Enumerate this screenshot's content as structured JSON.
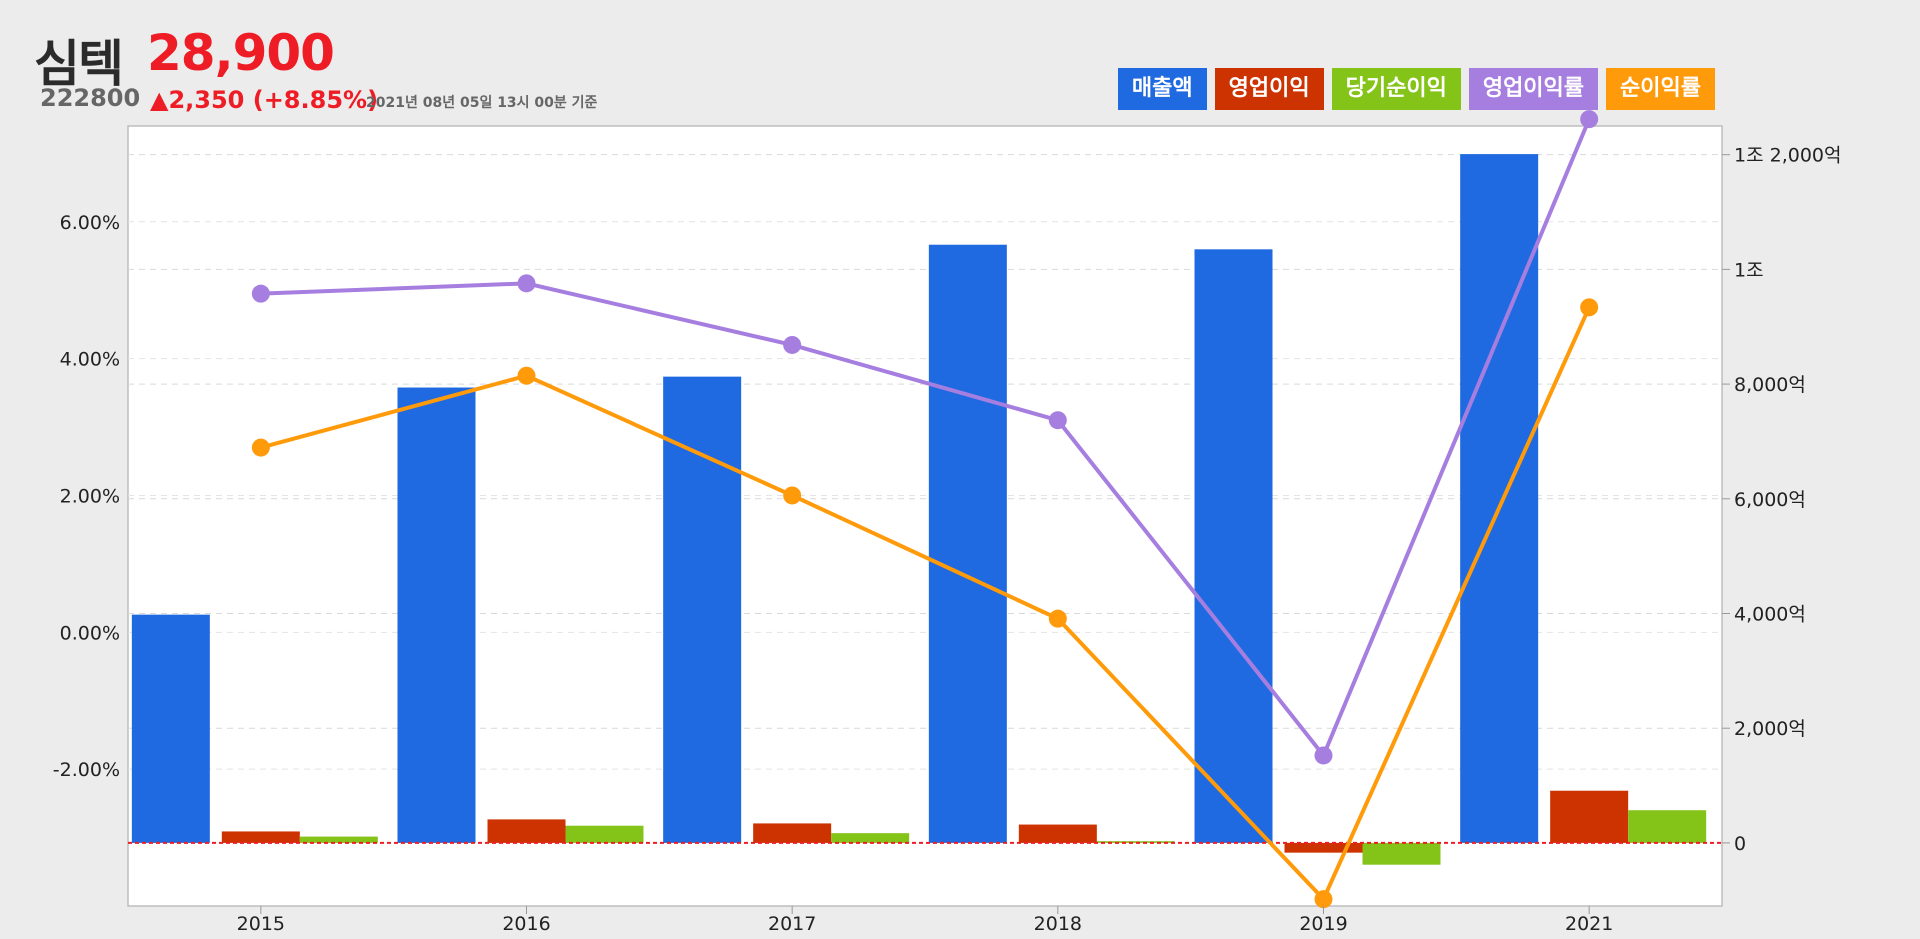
{
  "stock": {
    "name": "심텍",
    "price": "28,900",
    "code": "222800",
    "change": "▲2,350 (+8.85%)",
    "timestamp": "2021년 08년 05일 13시 00분 기준"
  },
  "legend": [
    {
      "label": "매출액",
      "color": "#1f6ae0"
    },
    {
      "label": "영업이익",
      "color": "#cc3300"
    },
    {
      "label": "당기순이익",
      "color": "#84c418"
    },
    {
      "label": "영업이익률",
      "color": "#a67ee0"
    },
    {
      "label": "순이익률",
      "color": "#ff9a0a"
    }
  ],
  "chart_data": {
    "type": "bar",
    "categories": [
      "2015",
      "2016",
      "2017",
      "2018",
      "2019",
      "2021"
    ],
    "left_axis": {
      "ticks": [
        6,
        4,
        2,
        0,
        -2
      ],
      "tick_labels": [
        "6.00%",
        "4.00%",
        "2.00%",
        "0.00%",
        "-2.00%"
      ],
      "range": [
        -4.0,
        7.4
      ]
    },
    "right_axis": {
      "ticks": [
        12000,
        10000,
        8000,
        6000,
        4000,
        2000,
        0
      ],
      "tick_labels": [
        "1조 2,000억",
        "1조",
        "8,000억",
        "6,000억",
        "4,000억",
        "2,000억",
        "0"
      ],
      "range": [
        -1100,
        12500
      ]
    },
    "bar_series": [
      {
        "name": "매출액",
        "color": "#1f6ae0",
        "values": [
          3980,
          7940,
          8130,
          10430,
          10350,
          12010
        ]
      },
      {
        "name": "영업이익",
        "color": "#cc3300",
        "values": [
          200,
          410,
          340,
          320,
          -170,
          910
        ]
      },
      {
        "name": "당기순이익",
        "color": "#84c418",
        "values": [
          110,
          300,
          170,
          30,
          -380,
          570
        ]
      }
    ],
    "line_series": [
      {
        "name": "영업이익률",
        "color": "#a67ee0",
        "values": [
          4.95,
          5.1,
          4.2,
          3.1,
          -1.8,
          7.5
        ]
      },
      {
        "name": "순이익률",
        "color": "#ff9a0a",
        "values": [
          2.7,
          3.75,
          2.0,
          0.2,
          -3.9,
          4.75
        ]
      }
    ],
    "grid": true,
    "zero_line_color": "#ee1c25"
  }
}
